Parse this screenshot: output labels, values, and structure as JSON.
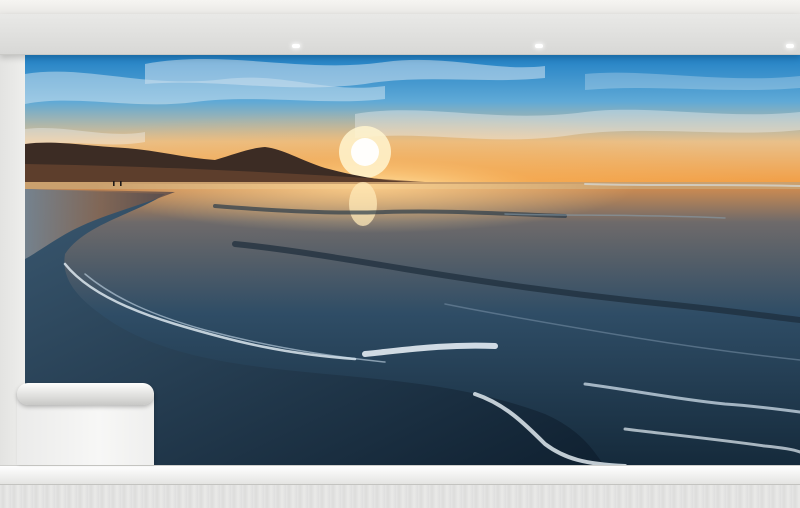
{
  "scene": {
    "subject": "beach-sunset-wall-mural",
    "colors": {
      "sky_top": "#2a8fd0",
      "sky_glow": "#f5a94a",
      "sun": "#fff7d6",
      "mountain": "#3a2a22",
      "sea": "#1d3c55",
      "foam": "#eaf4fb",
      "wall": "#eeeeec",
      "baseboard": "#f4f4f2"
    }
  }
}
